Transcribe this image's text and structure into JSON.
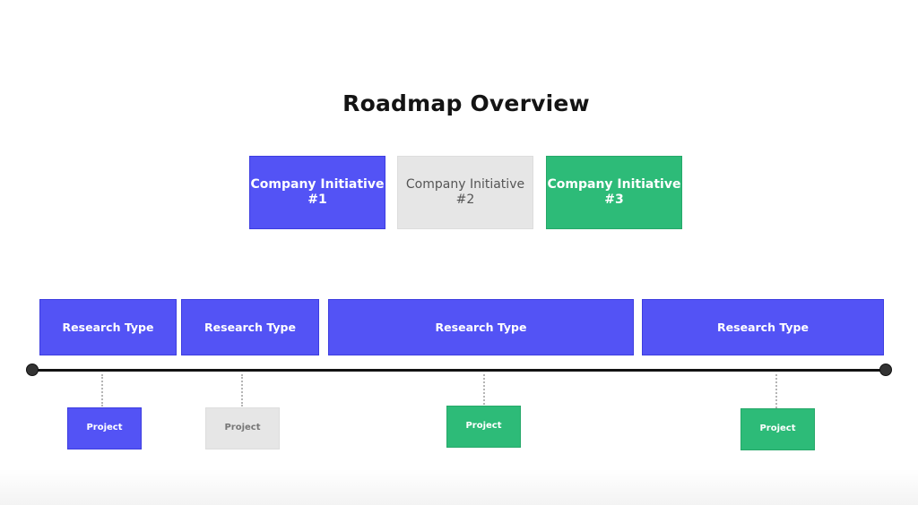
{
  "title": "Roadmap Overview",
  "colors": {
    "blue": "#5353f5",
    "grey": "#e6e6e6",
    "green": "#2dbb78",
    "timeline": "#121212"
  },
  "initiatives": [
    {
      "line1": "Company Initiative",
      "line2": "#1",
      "color": "blue"
    },
    {
      "line1": "Company Initiative",
      "line2": "#2",
      "color": "grey"
    },
    {
      "line1": "Company Initiative",
      "line2": "#3",
      "color": "green"
    }
  ],
  "research_types": [
    {
      "label": "Research Type"
    },
    {
      "label": "Research Type"
    },
    {
      "label": "Research Type"
    },
    {
      "label": "Research Type"
    }
  ],
  "projects": [
    {
      "label": "Project",
      "color": "blue"
    },
    {
      "label": "Project",
      "color": "grey"
    },
    {
      "label": "Project",
      "color": "green"
    },
    {
      "label": "Project",
      "color": "green"
    }
  ]
}
